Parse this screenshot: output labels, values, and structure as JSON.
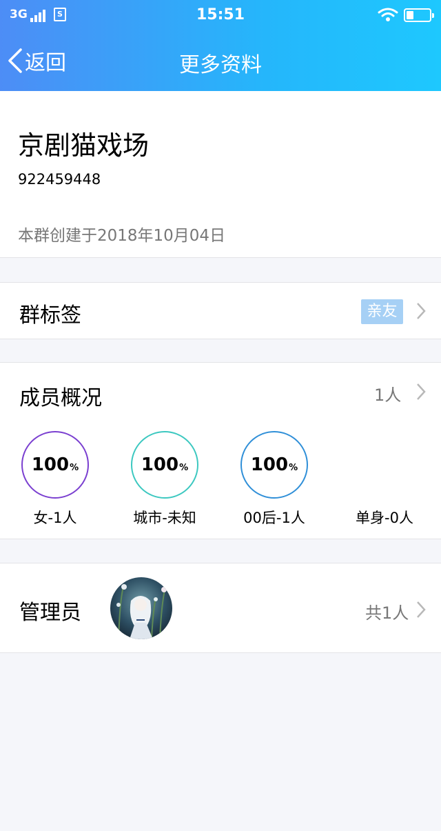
{
  "status_bar": {
    "network": "3G",
    "sim": "S",
    "time": "15:51",
    "battery_level": 0.3
  },
  "nav": {
    "back_label": "返回",
    "title": "更多资料"
  },
  "group": {
    "name": "京剧猫戏场",
    "id": "922459448",
    "created": "本群创建于2018年10月04日"
  },
  "tag_row": {
    "label": "群标签",
    "tag": "亲友"
  },
  "members_row": {
    "label": "成员概况",
    "count": "1人"
  },
  "stats": [
    {
      "value": "100",
      "unit": "%",
      "label": "女-1人",
      "color": "#7a3fd0"
    },
    {
      "value": "100",
      "unit": "%",
      "label": "城市-未知",
      "color": "#3cc8c0"
    },
    {
      "value": "100",
      "unit": "%",
      "label": "00后-1人",
      "color": "#2f8fd8"
    },
    {
      "label": "单身-0人"
    }
  ],
  "admin_row": {
    "label": "管理员",
    "count": "共1人"
  },
  "colors": {
    "accent_start": "#4d8df6",
    "accent_end": "#1ec8fe",
    "tag_bg": "#a6d0f5"
  }
}
